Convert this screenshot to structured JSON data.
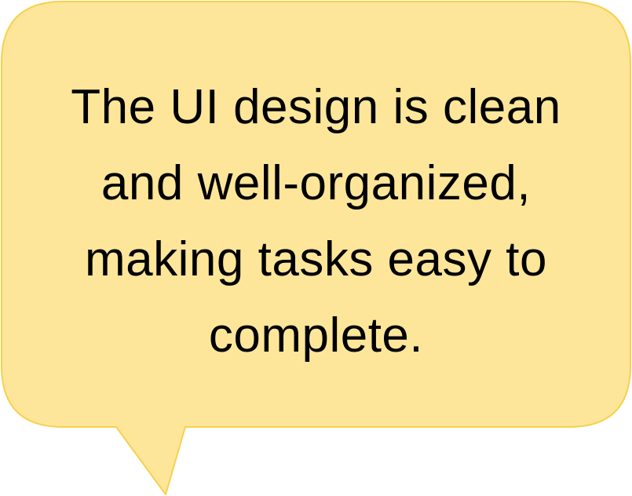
{
  "bubble": {
    "fill_color": "#FDE69A",
    "stroke_color": "#F6D14E",
    "text_color": "#000000",
    "lines": [
      "The UI design is clean",
      "and well-organized,",
      "making tasks easy to",
      "complete."
    ]
  }
}
